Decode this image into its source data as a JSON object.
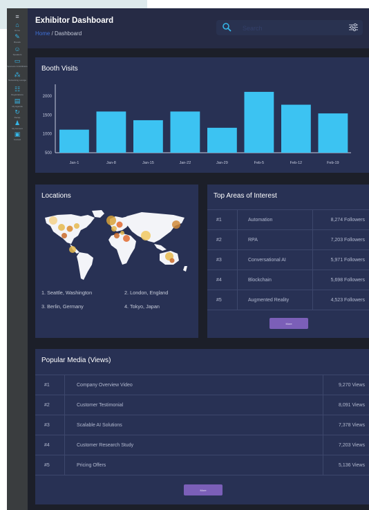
{
  "colors": {
    "accent_blue": "#3cc3f2",
    "button_purple": "#7b5fb8",
    "panel": "#283154",
    "header": "#262b45"
  },
  "sidebar": {
    "items": [
      {
        "icon": "menu-icon",
        "glyph": "≡",
        "label": ""
      },
      {
        "icon": "home-icon",
        "glyph": "⌂",
        "label": "Home"
      },
      {
        "icon": "brush-icon",
        "glyph": "✎",
        "label": "Brands"
      },
      {
        "icon": "users-icon",
        "glyph": "☺",
        "label": "Speakers"
      },
      {
        "icon": "monitor-icon",
        "glyph": "▭",
        "label": "Sponsors & Exhibitors"
      },
      {
        "icon": "network-icon",
        "glyph": "⁂",
        "label": "Networking Lounge"
      },
      {
        "icon": "groups-icon",
        "glyph": "☷",
        "label": "Registrations"
      },
      {
        "icon": "calendar-icon",
        "glyph": "▤",
        "label": "My Agenda"
      },
      {
        "icon": "refresh-icon",
        "glyph": "↻",
        "label": "Recap"
      },
      {
        "icon": "person-icon",
        "glyph": "♟",
        "label": "My Account"
      },
      {
        "icon": "contact-icon",
        "glyph": "▣",
        "label": "Contact"
      }
    ]
  },
  "header": {
    "title": "Exhibitor Dashboard",
    "breadcrumb_home": "Home",
    "breadcrumb_sep": " / ",
    "breadcrumb_current": "Dashboard",
    "search_placeholder": "Search"
  },
  "booth_visits": {
    "title": "Booth Visits",
    "chart_data": {
      "type": "bar",
      "title": "Booth Visits",
      "categories": [
        "Jan-1",
        "Jan-8",
        "Jan-15",
        "Jan-22",
        "Jan-29",
        "Feb-5",
        "Feb-12",
        "Feb-19"
      ],
      "values": [
        1110,
        1590,
        1360,
        1590,
        1160,
        2110,
        1770,
        1540
      ],
      "y_ticks": [
        "500",
        "1000",
        "1500",
        "2000"
      ],
      "ylim": [
        500,
        2200
      ],
      "bar_color": "#3cc3f2",
      "grid": false,
      "legend": "none"
    }
  },
  "locations": {
    "title": "Locations",
    "items": [
      "1. Seattle, Washington",
      "2. London, England",
      "3. Berlin, Germany",
      "4. Tokyo, Japan"
    ]
  },
  "top_areas": {
    "title": "Top Areas of Interest",
    "rows": [
      {
        "rank": "#1",
        "name": "Automation",
        "followers": "8,274 Followers"
      },
      {
        "rank": "#2",
        "name": "RPA",
        "followers": "7,203 Followers"
      },
      {
        "rank": "#3",
        "name": "Conversational AI",
        "followers": "5,971 Followers"
      },
      {
        "rank": "#4",
        "name": "Blockchain",
        "followers": "5,698 Followers"
      },
      {
        "rank": "#5",
        "name": "Augmented Reality",
        "followers": "4,523 Followers"
      }
    ],
    "more_label": "More"
  },
  "popular_media": {
    "title": "Popular Media (Views)",
    "rows": [
      {
        "rank": "#1",
        "name": "Company Overview Video",
        "views": "9,270 Views"
      },
      {
        "rank": "#2",
        "name": "Customer Testimonial",
        "views": "8,091 Views"
      },
      {
        "rank": "#3",
        "name": "Scalable AI Solutions",
        "views": "7,378 Views"
      },
      {
        "rank": "#4",
        "name": "Customer Research Study",
        "views": "7,203 Views"
      },
      {
        "rank": "#5",
        "name": "Pricing Offers",
        "views": "5,136 Views"
      }
    ],
    "more_label": "More"
  }
}
